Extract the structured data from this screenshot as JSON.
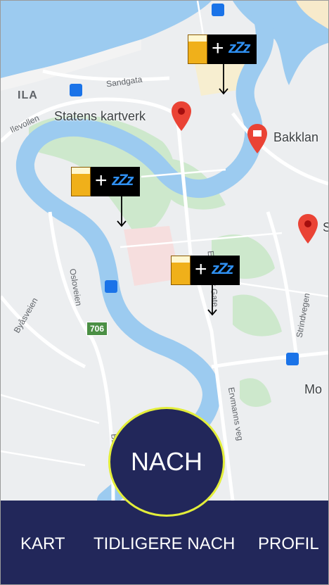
{
  "map": {
    "places": [
      {
        "name": "Statens kartverk"
      },
      {
        "name": "Bakklan"
      },
      {
        "name": "S"
      },
      {
        "name": "Mo"
      }
    ],
    "district": "ILA",
    "streets": [
      "Sandgata",
      "Ilevollen",
      "Osloveien",
      "Byåsveien",
      "Strindvegen",
      "Bøgens veg",
      "Ervmanns veg",
      "Elgeseter Gate"
    ],
    "road_shield": "706",
    "markers": [
      {
        "name": "beer-sleep-marker"
      },
      {
        "name": "beer-sleep-marker"
      },
      {
        "name": "beer-sleep-marker"
      }
    ],
    "marker_symbols": {
      "plus": "+",
      "zz": "zZz"
    }
  },
  "action_button": {
    "label": "NACH"
  },
  "tabs": [
    {
      "label": "KART"
    },
    {
      "label": "TIDLIGERE NACH"
    },
    {
      "label": "PROFIL"
    }
  ],
  "colors": {
    "tabbar": "#22275a",
    "button_border": "#e3ee3a",
    "water": "#9ccbf0",
    "pin": "#ea4335"
  }
}
